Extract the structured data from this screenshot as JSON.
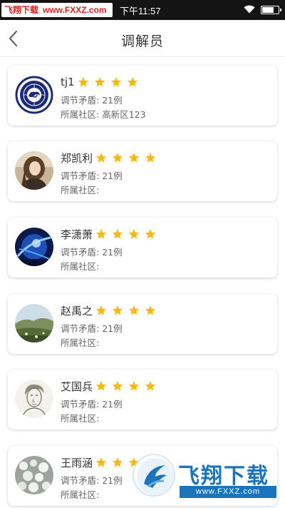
{
  "status_bar": {
    "watermark_site": "飞翔下载",
    "watermark_url": "www.FXXZ.com",
    "time": "下午11:57"
  },
  "header": {
    "title": "调解员"
  },
  "labels": {
    "mediation_prefix": "调节矛盾: ",
    "community_prefix": "所属社区: "
  },
  "mediators": [
    {
      "name": "tj1",
      "stars": 4,
      "mediation_count": "21例",
      "community": "高新区123",
      "avatar": "logo-avatar"
    },
    {
      "name": "郑凯利",
      "stars": 4,
      "mediation_count": "21例",
      "community": "",
      "avatar": "girl-photo-avatar"
    },
    {
      "name": "李潇萧",
      "stars": 4,
      "mediation_count": "21例",
      "community": "",
      "avatar": "blue-abstract-avatar"
    },
    {
      "name": "赵禹之",
      "stars": 4,
      "mediation_count": "21例",
      "community": "",
      "avatar": "landscape-avatar"
    },
    {
      "name": "艾国兵",
      "stars": 4,
      "mediation_count": "21例",
      "community": "",
      "avatar": "sketch-portrait-avatar"
    },
    {
      "name": "王雨涵",
      "stars": 4,
      "mediation_count": "21例",
      "community": "",
      "avatar": "flowers-avatar"
    }
  ],
  "colors": {
    "star": "#f5b90f",
    "text_primary": "#333333",
    "text_secondary": "#666666",
    "watermark_blue": "#1b75bc"
  },
  "bottom_watermark": {
    "title": "飞翔下载",
    "url": "www.FXXZ.com"
  }
}
